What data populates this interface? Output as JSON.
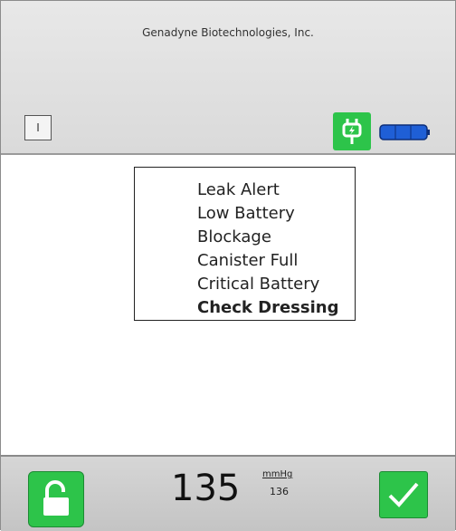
{
  "header": {
    "company": "Genadyne Biotechnologies, Inc.",
    "mode_label": "I",
    "icons": {
      "power": "power-plug-icon",
      "battery": "battery-icon"
    }
  },
  "alerts": [
    {
      "label": "Leak Alert",
      "bold": false
    },
    {
      "label": "Low Battery",
      "bold": false
    },
    {
      "label": "Blockage",
      "bold": false
    },
    {
      "label": "Canister Full",
      "bold": false
    },
    {
      "label": "Critical Battery",
      "bold": false
    },
    {
      "label": "Check Dressing",
      "bold": true
    }
  ],
  "footer": {
    "pressure_value": "135",
    "unit": "mmHg",
    "target_value": "136",
    "icons": {
      "left": "unlock-icon",
      "right": "checkmark-icon"
    }
  },
  "colors": {
    "accent_green": "#2dc44a",
    "battery_blue": "#1f5fd6"
  }
}
